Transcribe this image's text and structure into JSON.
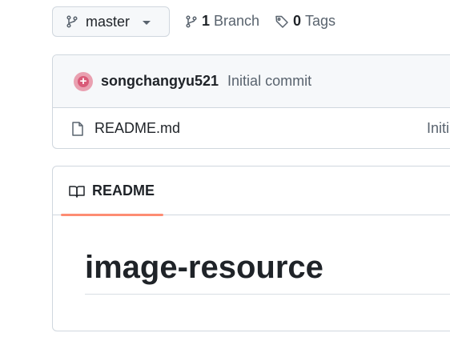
{
  "branch": {
    "current": "master"
  },
  "meta": {
    "branches_count": "1",
    "branches_label": "Branch",
    "tags_count": "0",
    "tags_label": "Tags"
  },
  "latest_commit": {
    "author": "songchangyu521",
    "message": "Initial commit"
  },
  "files": [
    {
      "name": "README.md",
      "commit_message": "Initi"
    }
  ],
  "readme": {
    "tab_label": "README",
    "heading": "image-resource",
    "accent_color": "#fd8c73"
  },
  "icons": {
    "branch": "git-branch-icon",
    "tag": "tag-icon",
    "file": "file-icon",
    "book": "book-icon",
    "caret": "chevron-down-icon"
  }
}
